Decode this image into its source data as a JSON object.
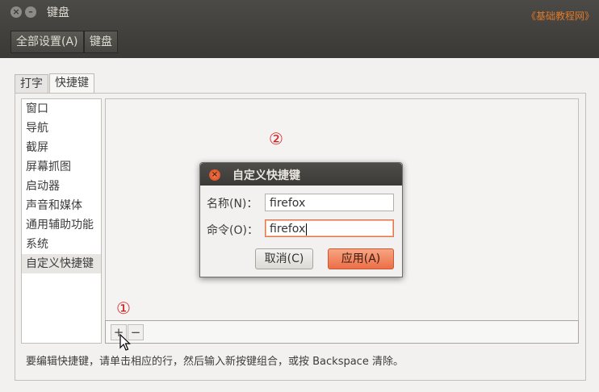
{
  "window": {
    "title": "键盘",
    "close_glyph": "×",
    "minimize_glyph": "–"
  },
  "watermark": "《基础教程网》",
  "breadcrumb": {
    "all_settings": "全部设置(A)",
    "current": "键盘"
  },
  "tabs": [
    {
      "label": "打字"
    },
    {
      "label": "快捷键"
    }
  ],
  "categories": [
    {
      "label": "窗口"
    },
    {
      "label": "导航"
    },
    {
      "label": "截屏"
    },
    {
      "label": "屏幕抓图"
    },
    {
      "label": "启动器"
    },
    {
      "label": "声音和媒体"
    },
    {
      "label": "通用辅助功能"
    },
    {
      "label": "系统"
    },
    {
      "label": "自定义快捷键"
    }
  ],
  "toolbar": {
    "add": "+",
    "remove": "−"
  },
  "help_text": "要编辑快捷键，请单击相应的行，然后输入新按键组合，或按 Backspace 清除。",
  "markers": {
    "one": "①",
    "two": "②"
  },
  "dialog": {
    "title": "自定义快捷键",
    "close_glyph": "×",
    "name_label": "名称(N)：",
    "name_value": "firefox",
    "command_label": "命令(O)：",
    "command_value": "firefox",
    "cancel_label": "取消(C)",
    "apply_label": "应用(A)"
  },
  "colors": {
    "accent": "#ec6e46",
    "marker": "#d32020",
    "titlebar": "#3a3935"
  }
}
